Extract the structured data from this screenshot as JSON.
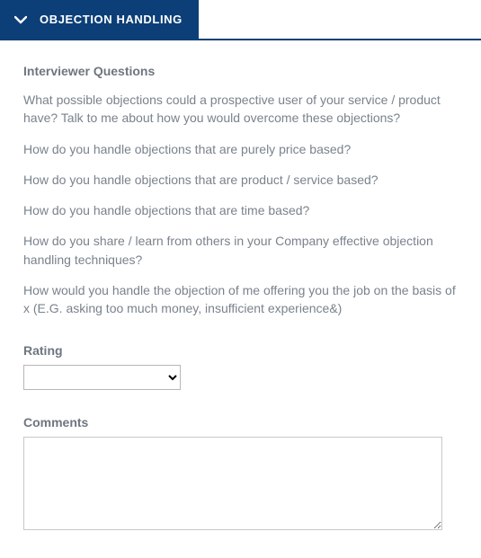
{
  "header": {
    "title": "OBJECTION HANDLING"
  },
  "section": {
    "title": "Interviewer Questions"
  },
  "questions": [
    "What possible objections could a prospective user of your service / product have? Talk to me about how you would overcome these objections?",
    "How do you handle objections that are purely price based?",
    "How do you handle objections that are product / service based?",
    "How do you handle objections that are time based?",
    "How do you share / learn from others in your Company effective objection handling techniques?",
    "How would you handle the objection of me offering you the job on the basis of x (E.G. asking too much money, insufficient experience&)"
  ],
  "fields": {
    "rating_label": "Rating",
    "rating_value": "",
    "comments_label": "Comments",
    "comments_value": ""
  }
}
